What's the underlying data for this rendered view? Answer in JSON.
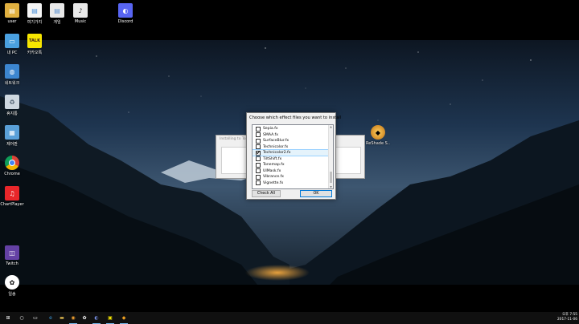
{
  "desktop_icons": [
    {
      "label": "user",
      "icon": "user-folder-icon",
      "color": "#e0b040"
    },
    {
      "label": "여기가지",
      "icon": "document-icon",
      "color": "#4a90d9"
    },
    {
      "label": "게임",
      "icon": "game-shortcut-icon",
      "color": "#5a8fd0"
    },
    {
      "label": "Music",
      "icon": "music-file-icon",
      "color": "#e8e8e8"
    },
    {
      "label": "Discord",
      "icon": "discord-icon",
      "color": "#5865f2"
    },
    {
      "label": "내 PC",
      "icon": "this-pc-icon",
      "color": "#4aa0e0"
    },
    {
      "label": "카카오톡",
      "icon": "kakaotalk-icon",
      "color": "#f7e600"
    },
    {
      "label": "네트워크",
      "icon": "network-icon",
      "color": "#3c86d0"
    },
    {
      "label": "휴지통",
      "icon": "recycle-bin-icon",
      "color": "#cfd8e0"
    },
    {
      "label": "제어판",
      "icon": "control-panel-icon",
      "color": "#5aa0d8"
    },
    {
      "label": "Chrome",
      "icon": "chrome-icon",
      "color": "#db4437"
    },
    {
      "label": "ChartPlayer",
      "icon": "chartplayer-icon",
      "color": "#e8262a"
    },
    {
      "label": "Twitch",
      "icon": "twitch-icon",
      "color": "#6441a5"
    },
    {
      "label": "일송",
      "icon": "panda-icon",
      "color": "#ffffff"
    },
    {
      "label": "ReShade S..",
      "icon": "reshade-icon",
      "color": "#f0a020"
    }
  ],
  "installer": {
    "title": "Installing to ToB..."
  },
  "dialog": {
    "prompt": "Choose which effect files you want to install",
    "items": [
      {
        "label": "Sepia.fx",
        "checked": false
      },
      {
        "label": "SMAA.fx",
        "checked": false
      },
      {
        "label": "SurfaceBlur.fx",
        "checked": false
      },
      {
        "label": "Technicolor.fx",
        "checked": false
      },
      {
        "label": "Technicolor2.fx",
        "checked": true,
        "selected": true
      },
      {
        "label": "TiltShift.fx",
        "checked": false
      },
      {
        "label": "Tonemap.fx",
        "checked": false
      },
      {
        "label": "UIMask.fx",
        "checked": false
      },
      {
        "label": "Vibrance.fx",
        "checked": false
      },
      {
        "label": "Vignette.fx",
        "checked": false
      }
    ],
    "check_all_label": "Check All",
    "ok_label": "OK"
  },
  "taskbar": {
    "items": [
      {
        "icon": "start-windows-icon",
        "glyph": "⊞"
      },
      {
        "icon": "search-icon",
        "glyph": "○"
      },
      {
        "icon": "task-view-icon",
        "glyph": "▭"
      },
      {
        "icon": "edge-icon",
        "glyph": "e"
      },
      {
        "icon": "file-explorer-icon",
        "glyph": "▬"
      },
      {
        "icon": "chrome-taskbar-icon",
        "glyph": "◉"
      },
      {
        "icon": "panda-taskbar-icon",
        "glyph": "✿"
      },
      {
        "icon": "discord-taskbar-icon",
        "glyph": "◐"
      },
      {
        "icon": "kakaotalk-taskbar-icon",
        "glyph": "▣"
      },
      {
        "icon": "reshade-taskbar-icon",
        "glyph": "◆"
      }
    ],
    "time": "오후 7:55",
    "date": "2017-11-06"
  },
  "colors": {
    "accent": "#0078d7",
    "selection": "#e5f3fb"
  }
}
